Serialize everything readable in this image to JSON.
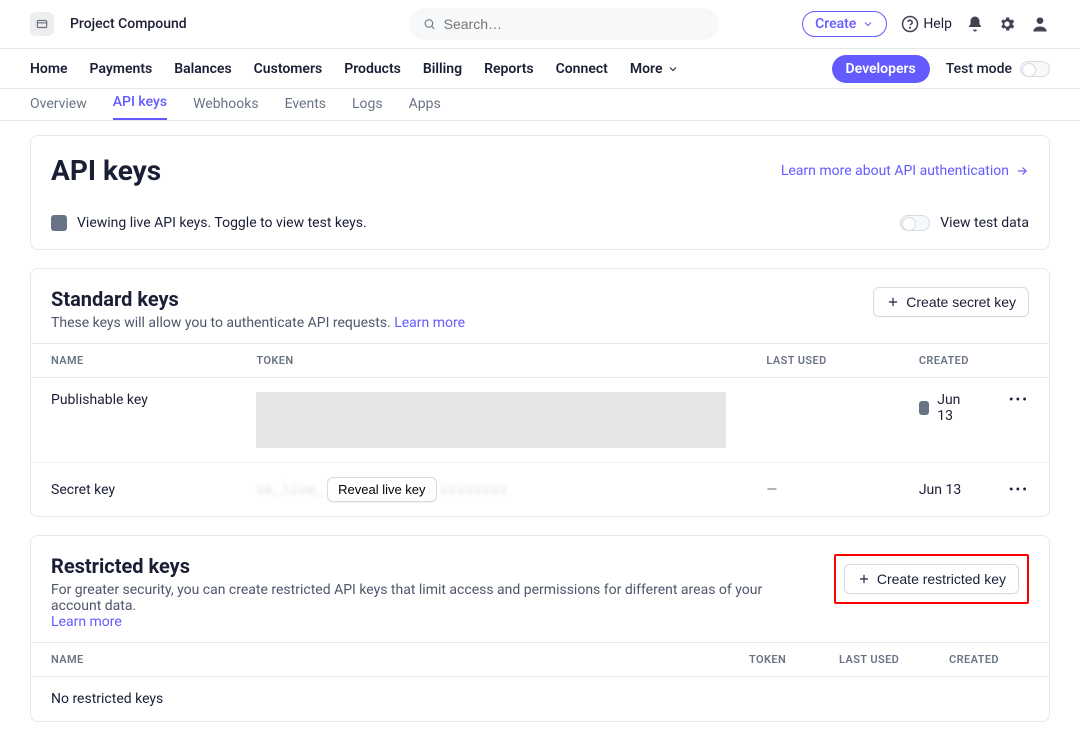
{
  "topbar": {
    "project_name": "Project Compound",
    "search_placeholder": "Search…",
    "create_label": "Create",
    "help_label": "Help"
  },
  "mainnav": {
    "items": [
      "Home",
      "Payments",
      "Balances",
      "Customers",
      "Products",
      "Billing",
      "Reports",
      "Connect"
    ],
    "more_label": "More",
    "developers_label": "Developers",
    "testmode_label": "Test mode"
  },
  "subnav": {
    "tabs": [
      "Overview",
      "API keys",
      "Webhooks",
      "Events",
      "Logs",
      "Apps"
    ],
    "active_index": 1
  },
  "header_panel": {
    "title": "API keys",
    "learn_more": "Learn more about API authentication",
    "notice": "Viewing live API keys. Toggle to view test keys.",
    "view_test_label": "View test data"
  },
  "standard": {
    "title": "Standard keys",
    "desc_prefix": "These keys will allow you to authenticate API requests. ",
    "learn_more": "Learn more",
    "create_btn": "Create secret key",
    "columns": {
      "name": "NAME",
      "token": "TOKEN",
      "last": "LAST USED",
      "created": "CREATED"
    },
    "rows": [
      {
        "name": "Publishable key",
        "token_redacted": true,
        "last": "",
        "created": "Jun 13",
        "has_info_icon": true
      },
      {
        "name": "Secret key",
        "reveal_label": "Reveal live key",
        "last": "—",
        "created": "Jun 13",
        "has_info_icon": false
      }
    ]
  },
  "restricted": {
    "title": "Restricted keys",
    "desc": "For greater security, you can create restricted API keys that limit access and permissions for different areas of your account data.",
    "learn_more": "Learn more",
    "create_btn": "Create restricted key",
    "columns": {
      "name": "NAME",
      "token": "TOKEN",
      "last": "LAST USED",
      "created": "CREATED"
    },
    "empty": "No restricted keys"
  }
}
